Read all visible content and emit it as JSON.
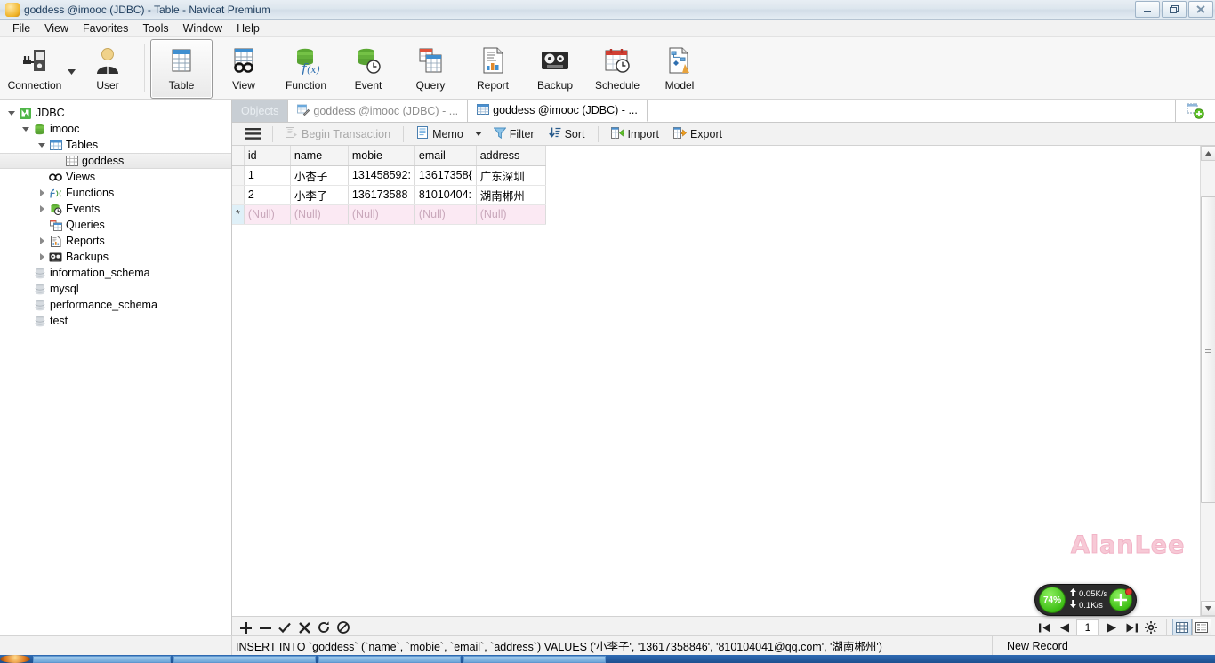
{
  "window": {
    "title": "goddess @imooc (JDBC) - Table - Navicat Premium",
    "icon": "navicat-app-icon",
    "controls": {
      "minimize": "minimize-button",
      "restore": "restore-button",
      "close": "close-button"
    }
  },
  "menubar": {
    "items": [
      {
        "label": "File"
      },
      {
        "label": "View"
      },
      {
        "label": "Favorites"
      },
      {
        "label": "Tools"
      },
      {
        "label": "Window"
      },
      {
        "label": "Help"
      }
    ]
  },
  "toolbar": {
    "items": [
      {
        "label": "Connection",
        "icon": "connection-icon",
        "active": false,
        "caret": true
      },
      {
        "label": "User",
        "icon": "user-icon",
        "active": false
      },
      {
        "label": "Table",
        "icon": "table-icon",
        "active": true
      },
      {
        "label": "View",
        "icon": "view-icon",
        "active": false
      },
      {
        "label": "Function",
        "icon": "function-icon",
        "active": false
      },
      {
        "label": "Event",
        "icon": "event-icon",
        "active": false
      },
      {
        "label": "Query",
        "icon": "query-icon",
        "active": false
      },
      {
        "label": "Report",
        "icon": "report-icon",
        "active": false
      },
      {
        "label": "Backup",
        "icon": "backup-icon",
        "active": false
      },
      {
        "label": "Schedule",
        "icon": "schedule-icon",
        "active": false
      },
      {
        "label": "Model",
        "icon": "model-icon",
        "active": false
      }
    ]
  },
  "sidebar": {
    "items": [
      {
        "label": "JDBC",
        "indent": 0,
        "twisty": "open",
        "icon": "navicat-connection-icon"
      },
      {
        "label": "imooc",
        "indent": 1,
        "twisty": "open",
        "icon": "database-icon"
      },
      {
        "label": "Tables",
        "indent": 2,
        "twisty": "open",
        "icon": "tables-folder-icon"
      },
      {
        "label": "goddess",
        "indent": 3,
        "twisty": "none",
        "icon": "table-item-icon",
        "selected": true
      },
      {
        "label": "Views",
        "indent": 2,
        "twisty": "none",
        "icon": "views-icon"
      },
      {
        "label": "Functions",
        "indent": 2,
        "twisty": "closed",
        "icon": "functions-icon"
      },
      {
        "label": "Events",
        "indent": 2,
        "twisty": "closed",
        "icon": "events-icon"
      },
      {
        "label": "Queries",
        "indent": 2,
        "twisty": "none",
        "icon": "queries-icon"
      },
      {
        "label": "Reports",
        "indent": 2,
        "twisty": "closed",
        "icon": "reports-icon"
      },
      {
        "label": "Backups",
        "indent": 2,
        "twisty": "closed",
        "icon": "backups-icon"
      },
      {
        "label": "information_schema",
        "indent": 1,
        "twisty": "none",
        "icon": "database-grey-icon"
      },
      {
        "label": "mysql",
        "indent": 1,
        "twisty": "none",
        "icon": "database-grey-icon"
      },
      {
        "label": "performance_schema",
        "indent": 1,
        "twisty": "none",
        "icon": "database-grey-icon"
      },
      {
        "label": "test",
        "indent": 1,
        "twisty": "none",
        "icon": "database-grey-icon"
      }
    ]
  },
  "tabs": {
    "objects_label": "Objects",
    "items": [
      {
        "label": "goddess @imooc (JDBC) - ...",
        "icon": "table-designer-icon",
        "active": false
      },
      {
        "label": "goddess @imooc (JDBC) - ...",
        "icon": "table-data-icon",
        "active": true
      }
    ],
    "add_tab_icon": "new-tab-icon"
  },
  "grid_toolbar": {
    "menu_icon": "hamburger-menu-icon",
    "buttons": [
      {
        "label": "Begin Transaction",
        "icon": "begin-transaction-icon",
        "disabled": true
      },
      {
        "label": "Memo",
        "icon": "memo-icon",
        "disabled": false,
        "caret": true
      },
      {
        "label": "Filter",
        "icon": "filter-icon",
        "disabled": false
      },
      {
        "label": "Sort",
        "icon": "sort-icon",
        "disabled": false
      },
      {
        "label": "Import",
        "icon": "import-icon",
        "disabled": false
      },
      {
        "label": "Export",
        "icon": "export-icon",
        "disabled": false
      }
    ]
  },
  "datagrid": {
    "columns": [
      "id",
      "name",
      "mobie",
      "email",
      "address"
    ],
    "selected_column": "id",
    "rows": [
      {
        "marker": "",
        "cells": [
          "1",
          "小杏子",
          "131458592:",
          "13617358{",
          "广东深圳"
        ]
      },
      {
        "marker": "",
        "cells": [
          "2",
          "小李子",
          "136173588",
          "81010404:",
          "湖南郴州"
        ]
      },
      {
        "marker": "*",
        "cells": [
          "(Null)",
          "(Null)",
          "(Null)",
          "(Null)",
          "(Null)"
        ],
        "is_new": true
      }
    ]
  },
  "bottom_toolbar": {
    "buttons": [
      {
        "icon": "add-record-icon",
        "glyph": "＋"
      },
      {
        "icon": "delete-record-icon",
        "glyph": "－"
      },
      {
        "icon": "apply-change-icon",
        "glyph": "✓"
      },
      {
        "icon": "discard-change-icon",
        "glyph": "✕"
      },
      {
        "icon": "refresh-icon",
        "glyph": "⟳"
      },
      {
        "icon": "stop-icon",
        "glyph": "⊘"
      }
    ],
    "nav": {
      "first_icon": "first-record-icon",
      "prev_icon": "previous-record-icon",
      "page_value": "1",
      "next_icon": "next-record-icon",
      "last_icon": "last-record-icon",
      "settings_icon": "grid-settings-icon",
      "grid_view_icon": "grid-view-icon",
      "form_view_icon": "form-view-icon"
    }
  },
  "statusbar": {
    "sql": "INSERT INTO `goddess` (`name`, `mobie`, `email`, `address`) VALUES ('小李子', '13617358846', '810104041@qq.com', '湖南郴州')",
    "status": "New Record"
  },
  "watermark": {
    "text": "AlanLee"
  },
  "netwidget": {
    "cpu": "74%",
    "upload": "0.05K/s",
    "download": "0.1K/s",
    "up_icon": "arrow-up-icon",
    "down_icon": "arrow-down-icon",
    "boost_icon": "boost-button-icon"
  },
  "colors": {
    "accent": "#3fbf16",
    "selected_header": "#dceaf6",
    "new_row": "#fbe9f3",
    "watermark": "#f7c9d6"
  }
}
